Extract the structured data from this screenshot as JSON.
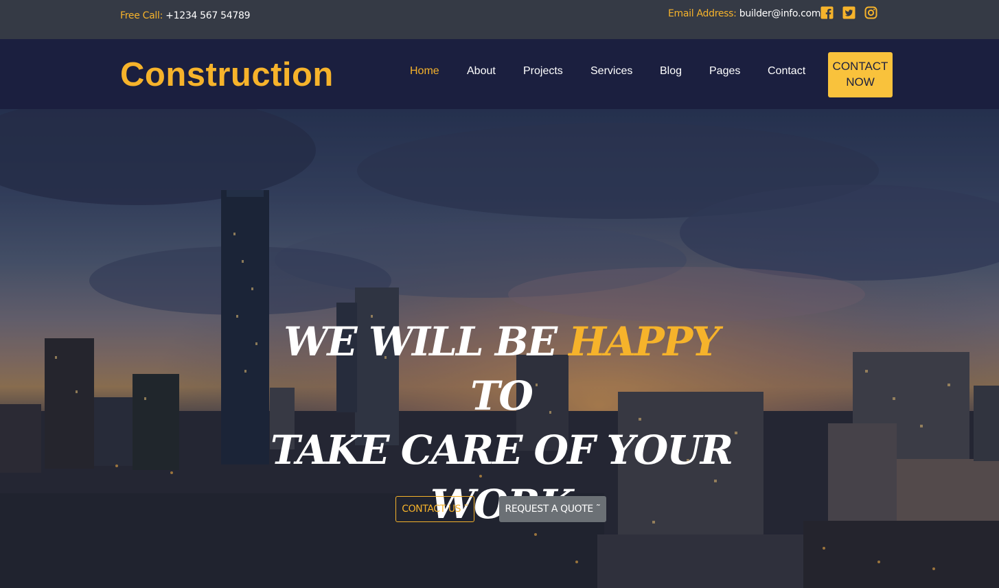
{
  "topbar": {
    "call_label": "Free Call:",
    "call_value": "+1234 567 54789",
    "email_label": "Email Address:",
    "email_value": "builder@info.com"
  },
  "header": {
    "logo": "Construction",
    "nav": {
      "home": "Home",
      "about": "About",
      "projects": "Projects",
      "services": "Services",
      "blog": "Blog",
      "pages": "Pages",
      "contact": "Contact"
    },
    "cta_line1": "CONTACT",
    "cta_line2": "NOW"
  },
  "hero": {
    "headline_part1": "WE WILL BE ",
    "headline_highlight": "HAPPY",
    "headline_part2": " TO",
    "headline_line2": "TAKE CARE OF YOUR",
    "headline_line3": "WORK",
    "button_contact": "CONTACT US ˜",
    "button_quote": "REQUEST A QUOTE ˜"
  },
  "colors": {
    "accent": "#f6b32b",
    "header_bg": "#1b1f3f",
    "topbar_bg": "#353a45",
    "cta_bg": "#f9c23c",
    "quote_button_bg": "#6b7075"
  },
  "icons": [
    "facebook-icon",
    "twitter-icon",
    "instagram-icon"
  ]
}
